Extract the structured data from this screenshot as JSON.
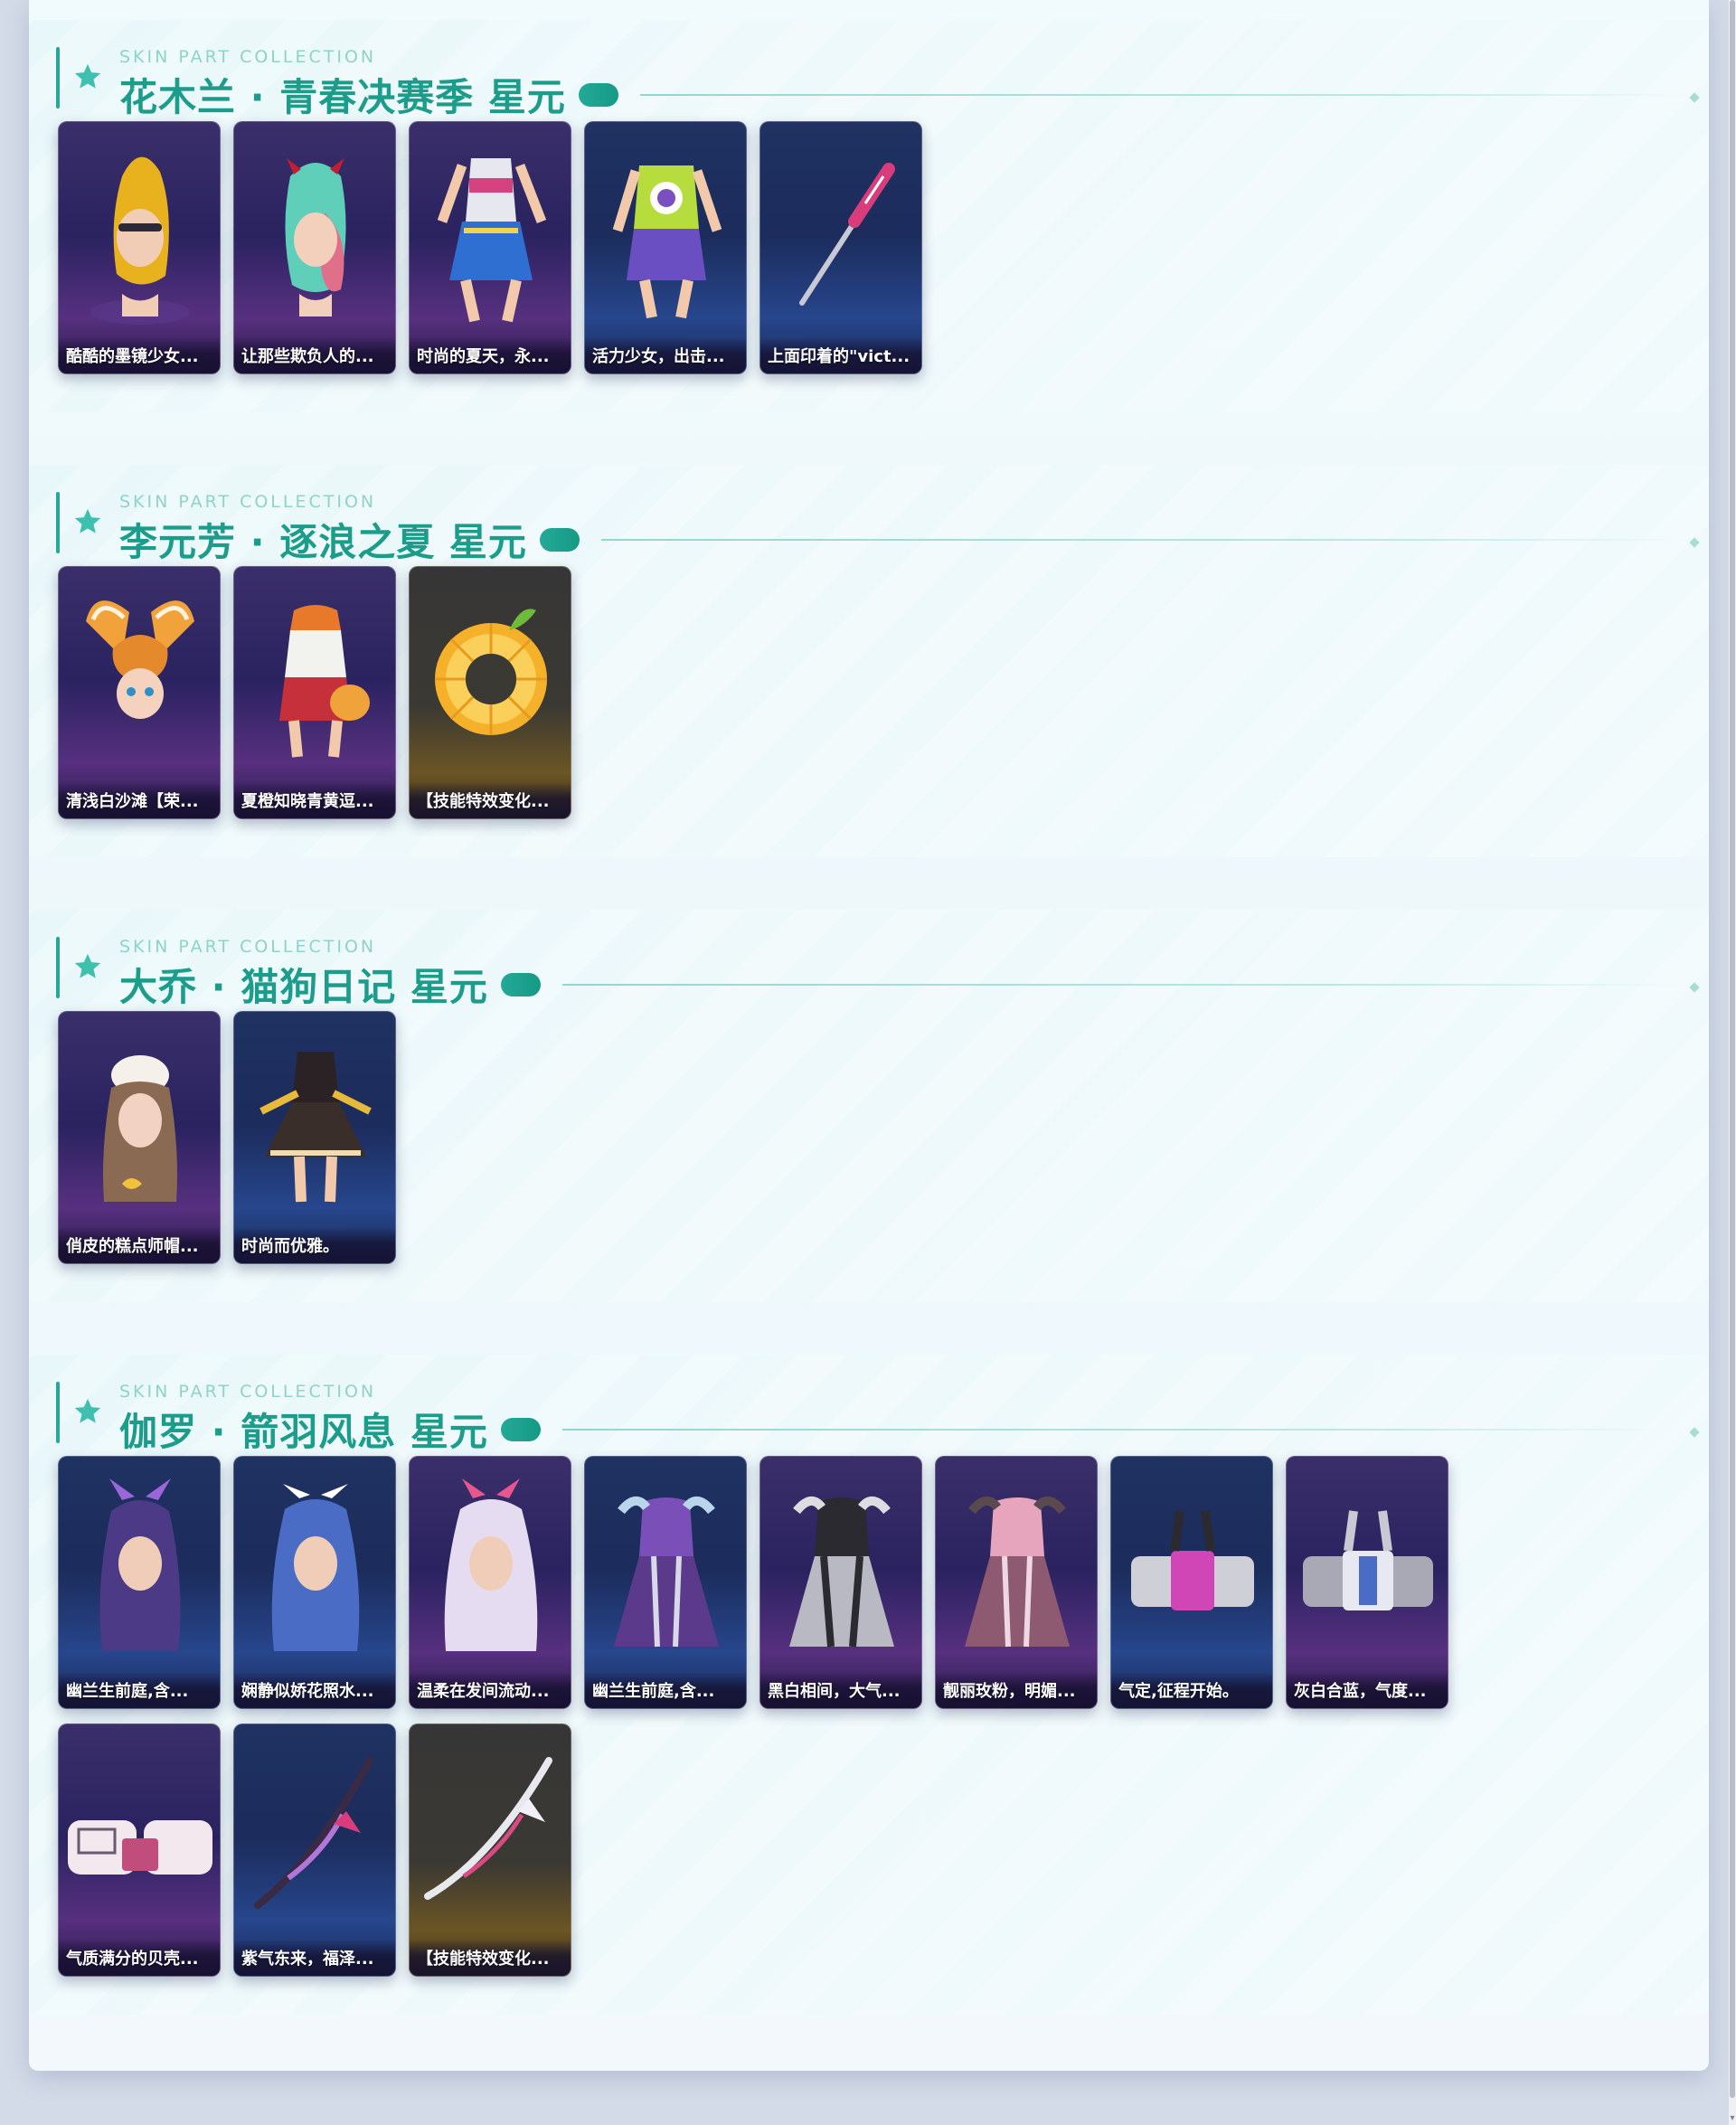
{
  "sections": [
    {
      "kicker": "SKIN PART COLLECTION",
      "title": "花木兰 · 青春决赛季 星元",
      "items": [
        {
          "caption": "酷酷的墨镜少女...",
          "icon": "hair-icon",
          "theme": "purple"
        },
        {
          "caption": "让那些欺负人的...",
          "icon": "hair-icon",
          "theme": "purple"
        },
        {
          "caption": "时尚的夏天，永...",
          "icon": "outfit-icon",
          "theme": "purple"
        },
        {
          "caption": "活力少女，出击...",
          "icon": "outfit-icon",
          "theme": "navy"
        },
        {
          "caption": "上面印着的\"vict...",
          "icon": "weapon-icon",
          "theme": "navy"
        }
      ]
    },
    {
      "kicker": "SKIN PART COLLECTION",
      "title": "李元芳 · 逐浪之夏 星元",
      "items": [
        {
          "caption": "清浅白沙滩【荣...",
          "icon": "hair-icon",
          "theme": "purple"
        },
        {
          "caption": "夏橙知晓青黄逗...",
          "icon": "outfit-icon",
          "theme": "purple"
        },
        {
          "caption": "【技能特效变化...",
          "icon": "effect-icon",
          "theme": "dark"
        }
      ]
    },
    {
      "kicker": "SKIN PART COLLECTION",
      "title": "大乔 · 猫狗日记 星元",
      "items": [
        {
          "caption": "俏皮的糕点师帽...",
          "icon": "hair-icon",
          "theme": "purple"
        },
        {
          "caption": "时尚而优雅。",
          "icon": "outfit-icon",
          "theme": "navy"
        }
      ]
    },
    {
      "kicker": "SKIN PART COLLECTION",
      "title": "伽罗 · 箭羽风息 星元",
      "items": [
        {
          "caption": "幽兰生前庭,含...",
          "icon": "hair-icon",
          "theme": "navy"
        },
        {
          "caption": "娴静似娇花照水...",
          "icon": "hair-icon",
          "theme": "navy"
        },
        {
          "caption": "温柔在发间流动...",
          "icon": "hair-icon",
          "theme": "purple"
        },
        {
          "caption": "幽兰生前庭,含...",
          "icon": "outfit-icon",
          "theme": "navy"
        },
        {
          "caption": "黑白相间，大气...",
          "icon": "outfit-icon",
          "theme": "purple"
        },
        {
          "caption": "靓丽玫粉，明媚...",
          "icon": "outfit-icon",
          "theme": "purple"
        },
        {
          "caption": "气定,征程开始。",
          "icon": "accessory-icon",
          "theme": "navy"
        },
        {
          "caption": "灰白合蓝，气度...",
          "icon": "accessory-icon",
          "theme": "purple"
        },
        {
          "caption": "气质满分的贝壳...",
          "icon": "accessory-icon",
          "theme": "purple"
        },
        {
          "caption": "紫气东来，福泽...",
          "icon": "weapon-icon",
          "theme": "navy"
        },
        {
          "caption": "【技能特效变化...",
          "icon": "effect-icon",
          "theme": "dark"
        }
      ]
    }
  ]
}
